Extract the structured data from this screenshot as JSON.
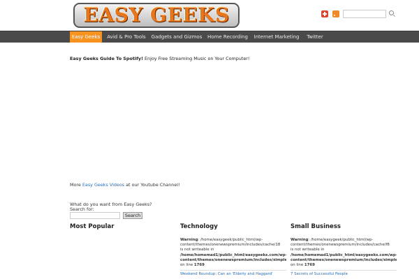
{
  "header": {
    "logo_text": "EASY GEEKS",
    "icons": [
      "google-plus-icon",
      "rss-icon",
      "search-icon"
    ],
    "search_placeholder": ""
  },
  "nav": {
    "items": [
      {
        "label": "Easy Geeks",
        "active": true
      },
      {
        "label": "Avid & Pro Tools",
        "active": false
      },
      {
        "label": "Gadgets and Gizmos",
        "active": false
      },
      {
        "label": "Home Recording",
        "active": false
      },
      {
        "label": "Internet Marketing",
        "active": false
      },
      {
        "label": "Twitter",
        "active": false
      }
    ]
  },
  "main": {
    "intro_bold": "Easy Geeks Guide To Spotify!",
    "intro_text": " Enjoy Free Streaming Music on Your Computer!",
    "more_prefix": "More ",
    "more_link": "Easy Geeks Videos",
    "more_suffix": " at our Youtube Channel!",
    "search_question": "What do you want from Easy Geeks?",
    "search_label": "Search for:",
    "search_value": "",
    "search_button": "Search"
  },
  "columns": [
    {
      "title": "Most Popular",
      "warning": null,
      "post": null
    },
    {
      "title": "Technology",
      "warning": {
        "label": "Warning",
        "line1": ": /home/easygeek/public_html/wp-",
        "line2": "content/themes/onenewspremium/includes/cache/18",
        "line3": "is not writeable in",
        "path1": "/home/homemad1/public_html/easygeeks.com/wp-",
        "path2": "content/themes/onenewspremium/includes/simplepie",
        "line_prefix": "on line ",
        "line_no": "1769"
      },
      "post": "Weekend Roundup: Can an 'Elderly and Haggard'"
    },
    {
      "title": "Small Business",
      "warning": {
        "label": "Warning",
        "line1": ": /home/easygeek/public_html/wp-",
        "line2": "content/themes/onenewspremium/includes/cache/f8",
        "line3": "is not writeable in",
        "path1": "/home/homemad1/public_html/easygeeks.com/wp-",
        "path2": "content/themes/onenewspremium/includes/simplepie",
        "line_prefix": "on line ",
        "line_no": "1769"
      },
      "post": "7 Secrets of Successful People"
    }
  ],
  "colors": {
    "nav_bg": "#4a4a4a",
    "nav_active": "#f7931e",
    "link": "#2a6db0",
    "logo_orange": "#e8761e"
  }
}
